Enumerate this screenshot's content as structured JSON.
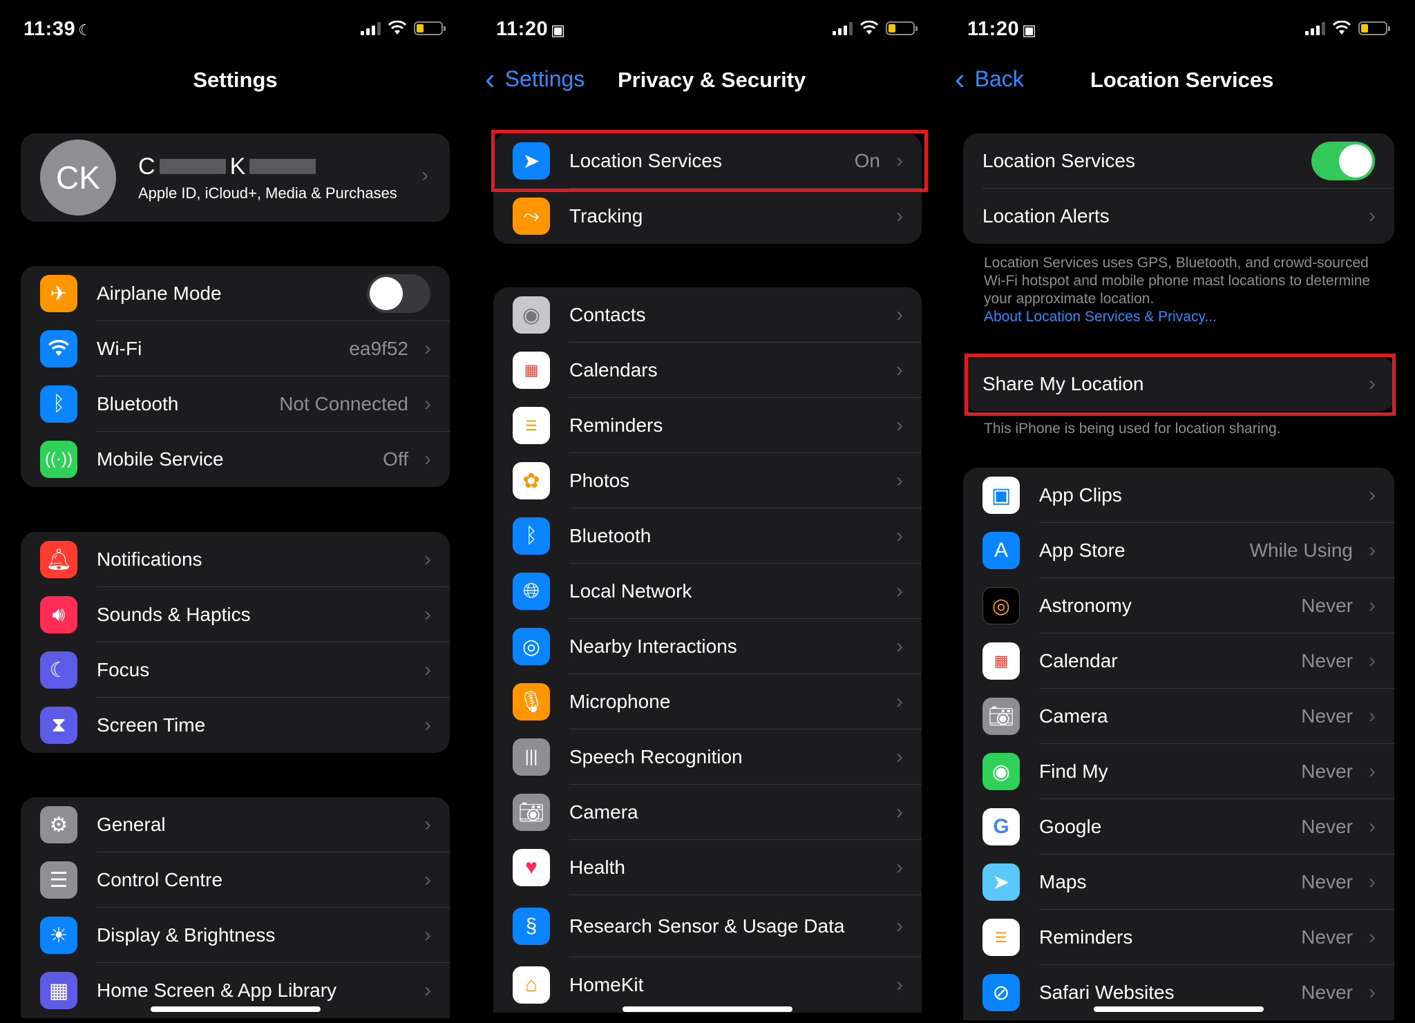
{
  "panel1": {
    "status": {
      "time": "11:39",
      "glyph": "☾"
    },
    "nav": {
      "title": "Settings"
    },
    "profile": {
      "initials": "CK",
      "name_first": "C",
      "name_last": "K",
      "subtitle": "Apple ID, iCloud+, Media & Purchases"
    },
    "group1": [
      {
        "label": "Airplane Mode",
        "icon": "airplane-icon",
        "color": "#ff9500"
      },
      {
        "label": "Wi-Fi",
        "value": "ea9f52",
        "icon": "wifi-icon",
        "color": "#0a84ff"
      },
      {
        "label": "Bluetooth",
        "value": "Not Connected",
        "icon": "bluetooth-icon",
        "color": "#0a84ff"
      },
      {
        "label": "Mobile Service",
        "value": "Off",
        "icon": "antenna-icon",
        "color": "#30d158"
      }
    ],
    "group2": [
      {
        "label": "Notifications",
        "icon": "bell-icon",
        "color": "#ff3b30"
      },
      {
        "label": "Sounds & Haptics",
        "icon": "speaker-icon",
        "color": "#ff2d55"
      },
      {
        "label": "Focus",
        "icon": "moon-icon",
        "color": "#5e5ce6"
      },
      {
        "label": "Screen Time",
        "icon": "hourglass-icon",
        "color": "#5e5ce6"
      }
    ],
    "group3": [
      {
        "label": "General",
        "icon": "gear-icon",
        "color": "#8e8e93"
      },
      {
        "label": "Control Centre",
        "icon": "switches-icon",
        "color": "#8e8e93"
      },
      {
        "label": "Display & Brightness",
        "icon": "sun-icon",
        "color": "#0a84ff"
      },
      {
        "label": "Home Screen & App Library",
        "icon": "grid-icon",
        "color": "#5e5ce6"
      }
    ]
  },
  "panel2": {
    "status": {
      "time": "11:20",
      "glyph": "▣"
    },
    "nav": {
      "back": "Settings",
      "title": "Privacy & Security"
    },
    "group1": [
      {
        "label": "Location Services",
        "value": "On",
        "icon": "location-arrow-icon",
        "color": "#0a84ff"
      },
      {
        "label": "Tracking",
        "icon": "tracking-icon",
        "color": "#ff9500"
      }
    ],
    "group2": [
      {
        "label": "Contacts",
        "icon": "contacts-icon",
        "color": "#c7c7cc"
      },
      {
        "label": "Calendars",
        "icon": "calendar-icon",
        "color": "#ffffff"
      },
      {
        "label": "Reminders",
        "icon": "reminders-icon",
        "color": "#ffffff"
      },
      {
        "label": "Photos",
        "icon": "photos-icon",
        "color": "#ffffff"
      },
      {
        "label": "Bluetooth",
        "icon": "bluetooth-icon",
        "color": "#0a84ff"
      },
      {
        "label": "Local Network",
        "icon": "globe-icon",
        "color": "#0a84ff"
      },
      {
        "label": "Nearby Interactions",
        "icon": "nearby-icon",
        "color": "#0a84ff"
      },
      {
        "label": "Microphone",
        "icon": "microphone-icon",
        "color": "#ff9500"
      },
      {
        "label": "Speech Recognition",
        "icon": "waveform-icon",
        "color": "#8e8e93"
      },
      {
        "label": "Camera",
        "icon": "camera-icon",
        "color": "#8e8e93"
      },
      {
        "label": "Health",
        "icon": "heart-icon",
        "color": "#ffffff"
      },
      {
        "label": "Research Sensor & Usage Data",
        "icon": "research-icon",
        "color": "#0a84ff"
      },
      {
        "label": "HomeKit",
        "icon": "home-icon",
        "color": "#ffffff"
      }
    ]
  },
  "panel3": {
    "status": {
      "time": "11:20",
      "glyph": "▣"
    },
    "nav": {
      "back": "Back",
      "title": "Location Services"
    },
    "group1": [
      {
        "label": "Location Services"
      },
      {
        "label": "Location Alerts"
      }
    ],
    "footer1": "Location Services uses GPS, Bluetooth, and crowd-sourced Wi-Fi hotspot and mobile phone mast locations to determine your approximate location.",
    "footer1_link": "About Location Services & Privacy...",
    "share": {
      "label": "Share My Location"
    },
    "footer2": "This iPhone is being used for location sharing.",
    "apps": [
      {
        "label": "App Clips",
        "icon": "app-clips-icon",
        "color": "#ffffff"
      },
      {
        "label": "App Store",
        "value": "While Using",
        "icon": "app-store-icon",
        "color": "#0a84ff"
      },
      {
        "label": "Astronomy",
        "value": "Never",
        "icon": "astronomy-icon",
        "color": "#000000"
      },
      {
        "label": "Calendar",
        "value": "Never",
        "icon": "calendar-icon",
        "color": "#ffffff"
      },
      {
        "label": "Camera",
        "value": "Never",
        "icon": "camera-icon",
        "color": "#8e8e93"
      },
      {
        "label": "Find My",
        "value": "Never",
        "icon": "find-my-icon",
        "color": "#30d158"
      },
      {
        "label": "Google",
        "value": "Never",
        "icon": "google-icon",
        "color": "#ffffff"
      },
      {
        "label": "Maps",
        "value": "Never",
        "icon": "maps-icon",
        "color": "#5ac8fa"
      },
      {
        "label": "Reminders",
        "value": "Never",
        "icon": "reminders-icon",
        "color": "#ffffff"
      },
      {
        "label": "Safari Websites",
        "value": "Never",
        "icon": "safari-icon",
        "color": "#0a84ff"
      }
    ]
  }
}
